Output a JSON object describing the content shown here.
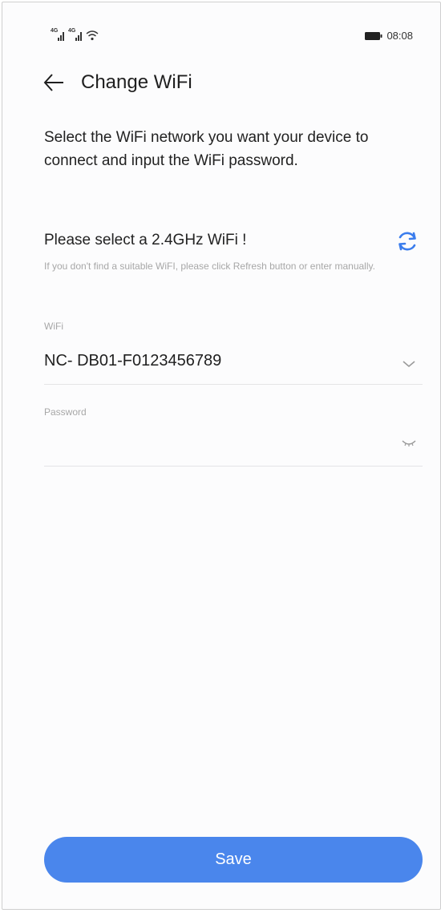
{
  "status_bar": {
    "signal_1_label": "4G",
    "signal_2_label": "4G",
    "time": "08:08"
  },
  "header": {
    "title": "Change WiFi"
  },
  "description": "Select the WiFi network you want your device to connect and input the WiFi password.",
  "wifi_section": {
    "title": "Please select a 2.4GHz WiFi !",
    "hint": "If you don't find a suitable WiFI, please click Refresh button or enter manually."
  },
  "wifi_field": {
    "label": "WiFi",
    "value": "NC- DB01-F0123456789"
  },
  "password_field": {
    "label": "Password",
    "value": ""
  },
  "save_button": {
    "label": "Save"
  },
  "colors": {
    "accent": "#4a86ec",
    "hint_text": "#a7a7a7",
    "divider": "#e4e4e6"
  },
  "icons": {
    "back": "arrow-left-icon",
    "refresh": "refresh-icon",
    "wifi_dropdown": "chevron-down-icon",
    "password_visibility": "eye-closed-icon"
  }
}
